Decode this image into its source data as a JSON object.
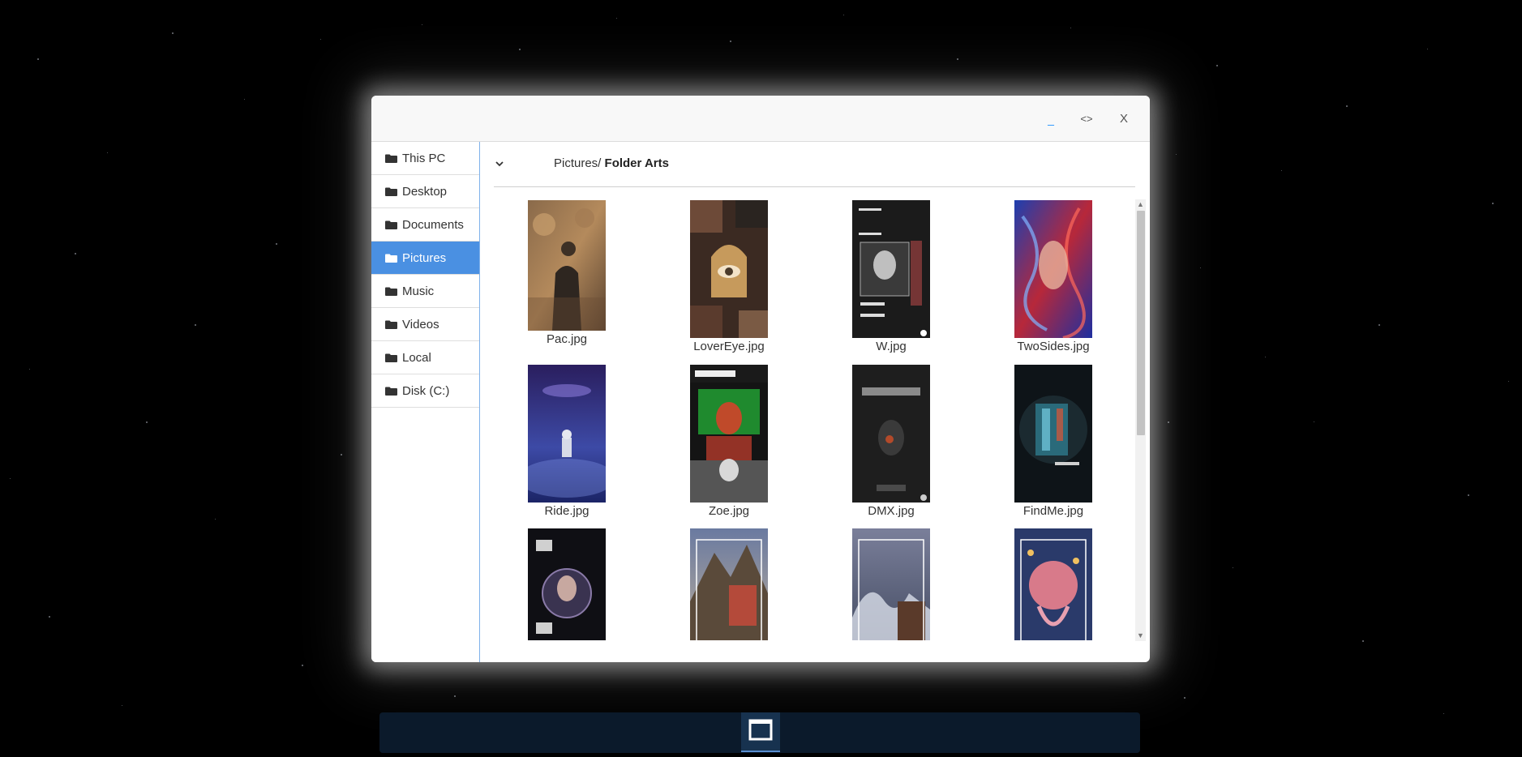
{
  "window_controls": {
    "minimize": "_",
    "maximize": "<>",
    "close": "X"
  },
  "sidebar": {
    "items": [
      {
        "label": "This PC",
        "icon": "folder-icon",
        "active": false
      },
      {
        "label": "Desktop",
        "icon": "folder-icon",
        "active": false
      },
      {
        "label": "Documents",
        "icon": "folder-icon",
        "active": false
      },
      {
        "label": "Pictures",
        "icon": "folder-icon",
        "active": true
      },
      {
        "label": "Music",
        "icon": "folder-icon",
        "active": false
      },
      {
        "label": "Videos",
        "icon": "folder-icon",
        "active": false
      },
      {
        "label": "Local",
        "icon": "folder-icon",
        "active": false
      },
      {
        "label": "Disk (C:)",
        "icon": "folder-icon",
        "active": false
      }
    ]
  },
  "pathbar": {
    "prefix": "Pictures/ ",
    "current": "Folder Arts"
  },
  "files": [
    {
      "name": "Pac.jpg"
    },
    {
      "name": "LoverEye.jpg"
    },
    {
      "name": "W.jpg"
    },
    {
      "name": "TwoSides.jpg"
    },
    {
      "name": "Ride.jpg"
    },
    {
      "name": "Zoe.jpg"
    },
    {
      "name": "DMX.jpg"
    },
    {
      "name": "FindMe.jpg"
    },
    {
      "name": ""
    },
    {
      "name": ""
    },
    {
      "name": ""
    },
    {
      "name": ""
    }
  ],
  "colors": {
    "accent": "#4a90e2",
    "desktop_bg": "#000000",
    "taskbar": "#0b1a2b"
  }
}
